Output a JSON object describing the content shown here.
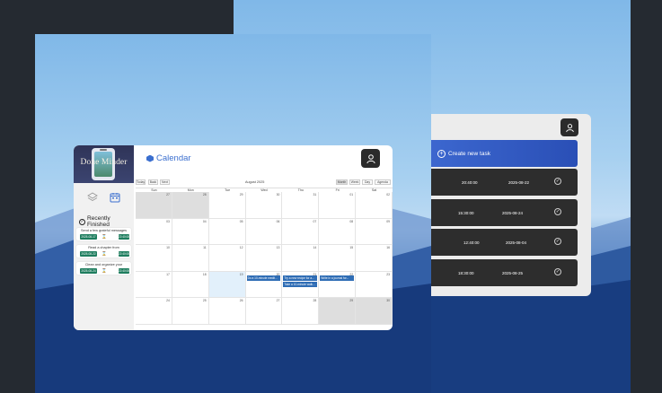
{
  "back_app": {
    "create_label": "Create new task",
    "tasks": [
      {
        "time": "20:40:00",
        "date": "2025-08-22"
      },
      {
        "time": "15:30:00",
        "date": "2025-08-24"
      },
      {
        "time": "12:40:00",
        "date": "2025-08-04"
      },
      {
        "time": "18:30:00",
        "date": "2025-08-25"
      }
    ]
  },
  "front_app": {
    "logo": "Done Minder",
    "page_title": "Calendar",
    "recent": {
      "title": "Recently Finished",
      "items": [
        {
          "text": "Send a few grateful messages",
          "date": "2025-08-17",
          "time": "22:40:00"
        },
        {
          "text": "Read a chapter from",
          "date": "2025-08-22",
          "time": "22:40:00"
        },
        {
          "text": "Clean and organize your",
          "date": "2025-08-24",
          "time": "22:40:00"
        }
      ]
    },
    "calendar": {
      "nav": {
        "today": "Today",
        "back": "Back",
        "next": "Next"
      },
      "month": "August 2025",
      "views": {
        "month": "Month",
        "week": "Week",
        "day": "Day",
        "agenda": "Agenda"
      },
      "weekdays": [
        "Sun",
        "Mon",
        "Tue",
        "Wed",
        "Thu",
        "Fri",
        "Sat"
      ],
      "weeks": [
        [
          "27",
          "28",
          "29",
          "30",
          "31",
          "01",
          "02"
        ],
        [
          "03",
          "04",
          "05",
          "06",
          "07",
          "08",
          "09"
        ],
        [
          "10",
          "11",
          "12",
          "13",
          "14",
          "15",
          "16"
        ],
        [
          "17",
          "18",
          "19",
          "20",
          "21",
          "22",
          "23"
        ],
        [
          "24",
          "25",
          "26",
          "27",
          "28",
          "29",
          "30"
        ]
      ],
      "events": {
        "wed": "Do a 10-minute medit...",
        "thu1": "Try a new recipe for a...",
        "thu2": "Take a 10-minute walk...",
        "fri": "Write in a journal for..."
      }
    }
  },
  "colors": {
    "accent": "#3b6fcf",
    "finished": "#1e7d5e",
    "event": "#2f6db5"
  }
}
